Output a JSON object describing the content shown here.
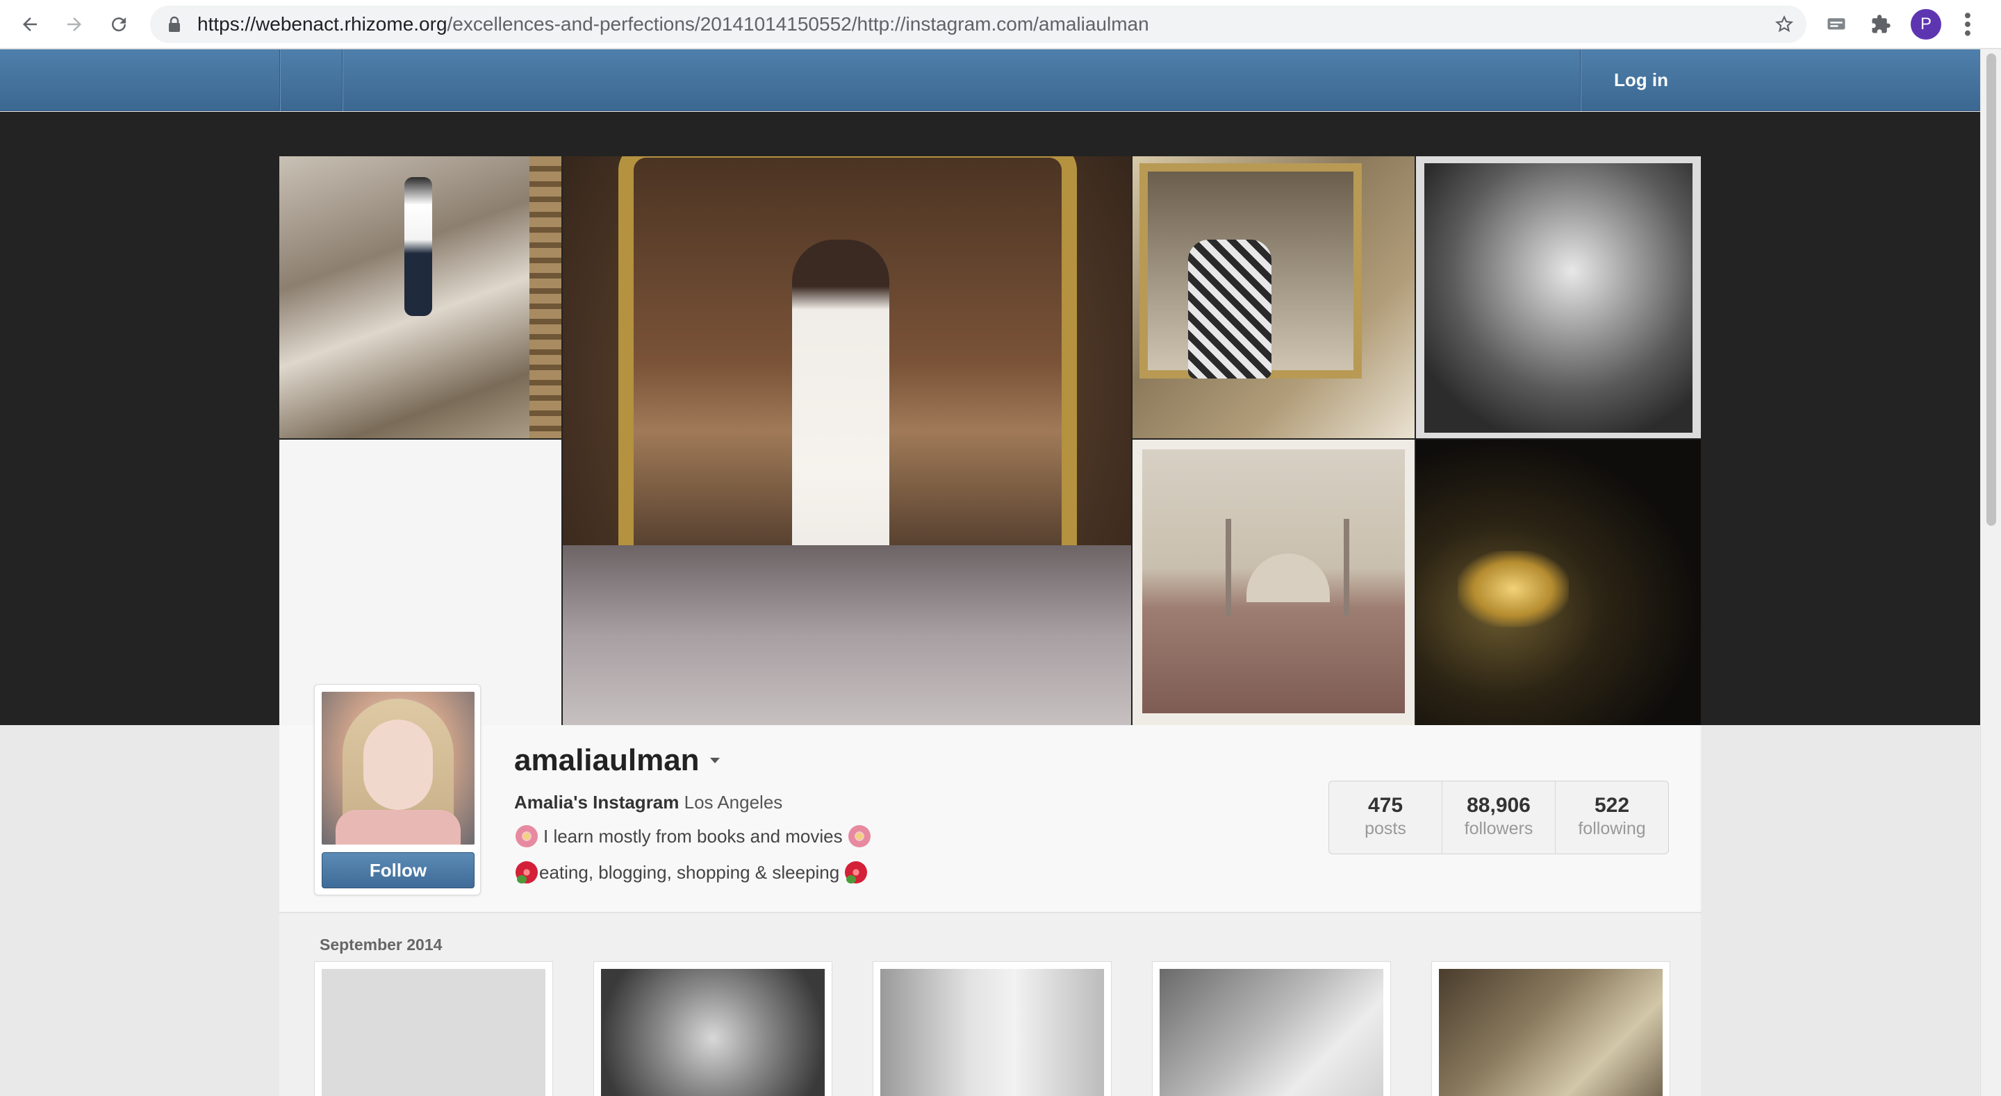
{
  "browser": {
    "url_host": "https://webenact.rhizome.org",
    "url_path": "/excellences-and-perfections/20141014150552/http://instagram.com/amaliaulman",
    "profile_initial": "P"
  },
  "topbar": {
    "login_label": "Log in"
  },
  "profile": {
    "username": "amaliaulman",
    "full_name": "Amalia's Instagram",
    "location": "Los Angeles",
    "bio_line1": "I learn mostly from books and movies",
    "bio_line2": "eating, blogging, shopping & sleeping",
    "follow_label": "Follow",
    "stats": {
      "posts": "475",
      "posts_label": "posts",
      "followers": "88,906",
      "followers_label": "followers",
      "following": "522",
      "following_label": "following"
    }
  },
  "feed": {
    "month_label": "September 2014"
  },
  "colors": {
    "topbar": "#3f6c96",
    "follow_button": "#4a79a5",
    "avatar_chip": "#5e35b1"
  }
}
